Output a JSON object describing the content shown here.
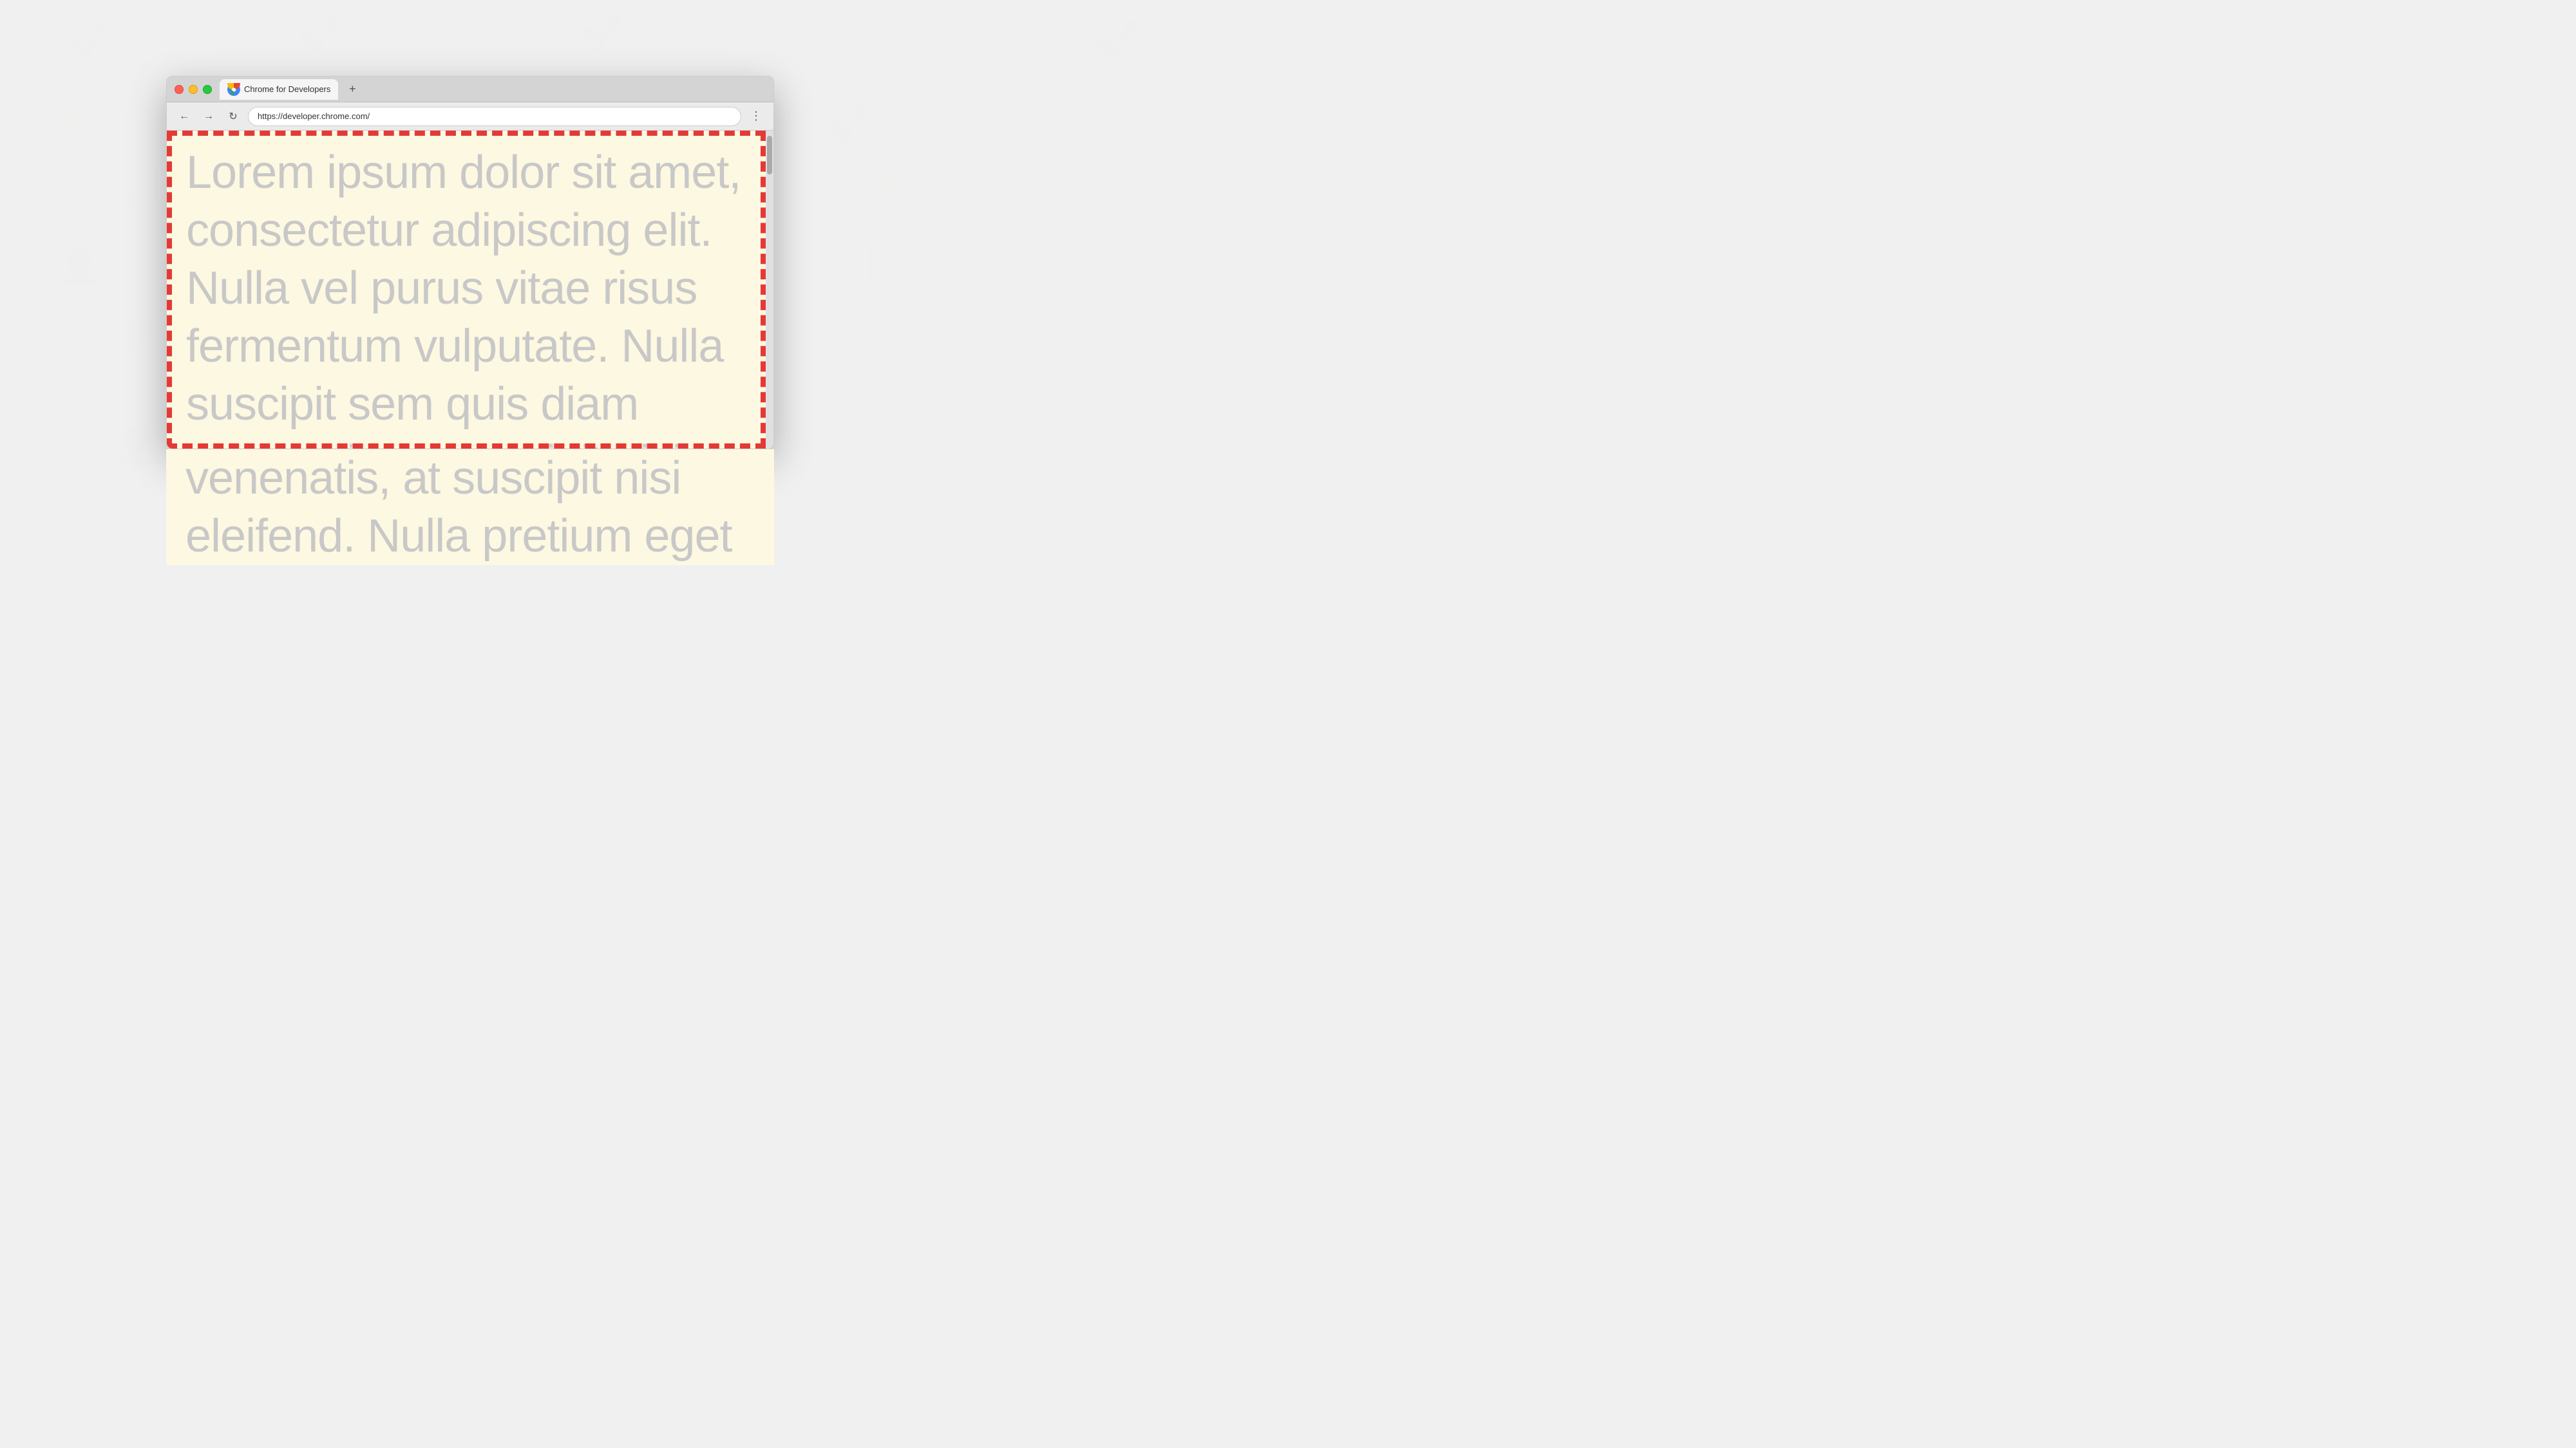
{
  "background": {
    "color": "#f0f0f0"
  },
  "browser": {
    "tab": {
      "title": "Chrome for Developers",
      "favicon": "chrome-logo"
    },
    "new_tab_label": "+",
    "address_bar": {
      "url": "https://developer.chrome.com/"
    },
    "nav": {
      "back_label": "←",
      "forward_label": "→",
      "reload_label": "↻",
      "menu_label": "⋮"
    },
    "traffic_lights": {
      "close": "#ff5f57",
      "minimize": "#febc2e",
      "maximize": "#28c840"
    }
  },
  "page": {
    "background_color": "#fdf8e1",
    "lorem_text": "Lorem ipsum dolor sit amet, consectetur adipiscing elit. Nulla vel purus vitae risus fermentum vulputate. Nulla suscipit sem quis diam venenatis, at suscipit nisi eleifend. Nulla pretium eget",
    "text_color": "#c8c8c8",
    "border_color": "#e53935",
    "border_style": "dashed"
  }
}
